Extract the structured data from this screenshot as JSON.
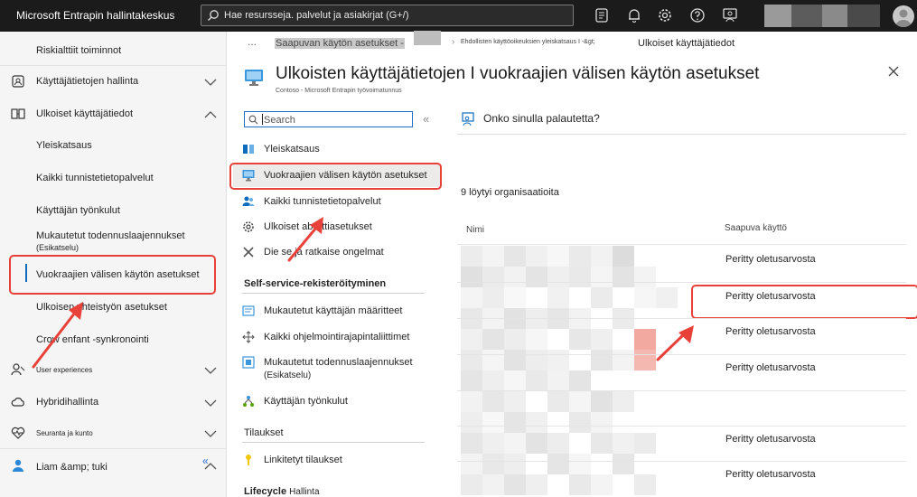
{
  "topbar": {
    "brand": "Microsoft Entrapin hallintakeskus",
    "search_placeholder": "Hae resursseja. palvelut ja asiakirjat (G+/)"
  },
  "leftnav": {
    "items": [
      {
        "label": "Riskialttiit toiminnot"
      },
      {
        "label": "Käyttäjätietojen hallinta"
      },
      {
        "label": "Ulkoiset käyttäjätiedot"
      },
      {
        "label": "Yleiskatsaus"
      },
      {
        "label": "Kaikki tunnistetietopalvelut"
      },
      {
        "label": "Käyttäjän työnkulut"
      },
      {
        "label": "Mukautetut todennuslaajennukset"
      },
      {
        "label": "(Esikatselu)"
      },
      {
        "label": "Vuokraajien välisen käytön asetukset"
      },
      {
        "label": "Ulkoisen yhteistyön asetukset"
      },
      {
        "label": "Crow enfant -synkronointi"
      },
      {
        "label": "User experiences"
      },
      {
        "label": "Hybridihallinta"
      },
      {
        "label": "Seuranta ja kunto"
      },
      {
        "label": "Liam &amp; tuki"
      }
    ],
    "collapse_glyph": "«"
  },
  "breadcrumb": {
    "ellipsis": "...",
    "item1": "Saapuvan käytön asetukset -",
    "item2": "Ehdollisten käyttöoikeuksien yleiskatsaus I -&gt;",
    "current": "Ulkoiset käyttäjätiedot"
  },
  "page": {
    "title": "Ulkoisten käyttäjätietojen I vuokraajien välisen käytön asetukset",
    "subtitle": "Contoso - Microsoft Entrapin työvoimatunnus"
  },
  "resource_menu": {
    "search_placeholder": "Search",
    "collapse_glyph": "«",
    "items": [
      {
        "label": "Yleiskatsaus"
      },
      {
        "label": "Vuokraajien välisen käytön asetukset"
      },
      {
        "label": "Kaikki tunnistetietopalvelut"
      },
      {
        "label": "Ulkoiset aborttiasetukset"
      },
      {
        "label": "Die se ja ratkaise ongelmat"
      }
    ],
    "section_selfservice": "Self-service-rekisteröityminen",
    "selfservice_items": [
      {
        "label": "Mukautetut käyttäjän määritteet"
      },
      {
        "label": "Kaikki ohjelmointirajapintaliittimet"
      },
      {
        "label": "Mukautetut todennuslaajennukset"
      },
      {
        "label": "(Esikatselu)"
      },
      {
        "label": "Käyttäjän työnkulut"
      }
    ],
    "section_subscriptions": "Tilaukset",
    "subscription_items": [
      {
        "label": "Linkitetyt tilaukset"
      }
    ],
    "section_lifecycle": "Lifecycle",
    "section_lifecycle_suffix": "Hallinta"
  },
  "content": {
    "feedback": "Onko sinulla palautetta?",
    "found": "9 löytyi organisaatioita",
    "columns": {
      "name": "Nimi",
      "access": "Saapuva käyttö"
    },
    "rows": [
      {
        "access": "Peritty oletusarvosta"
      },
      {
        "access": "Peritty oletusarvosta"
      },
      {
        "access": "Peritty oletusarvosta"
      },
      {
        "access": "Peritty oletusarvosta"
      },
      {
        "access": "Peritty oletusarvosta"
      },
      {
        "access": "Peritty oletusarvosta"
      }
    ]
  },
  "colors": {
    "accent": "#0f6cbd",
    "highlight": "#e8413a",
    "topbar": "#1b1b1b"
  }
}
